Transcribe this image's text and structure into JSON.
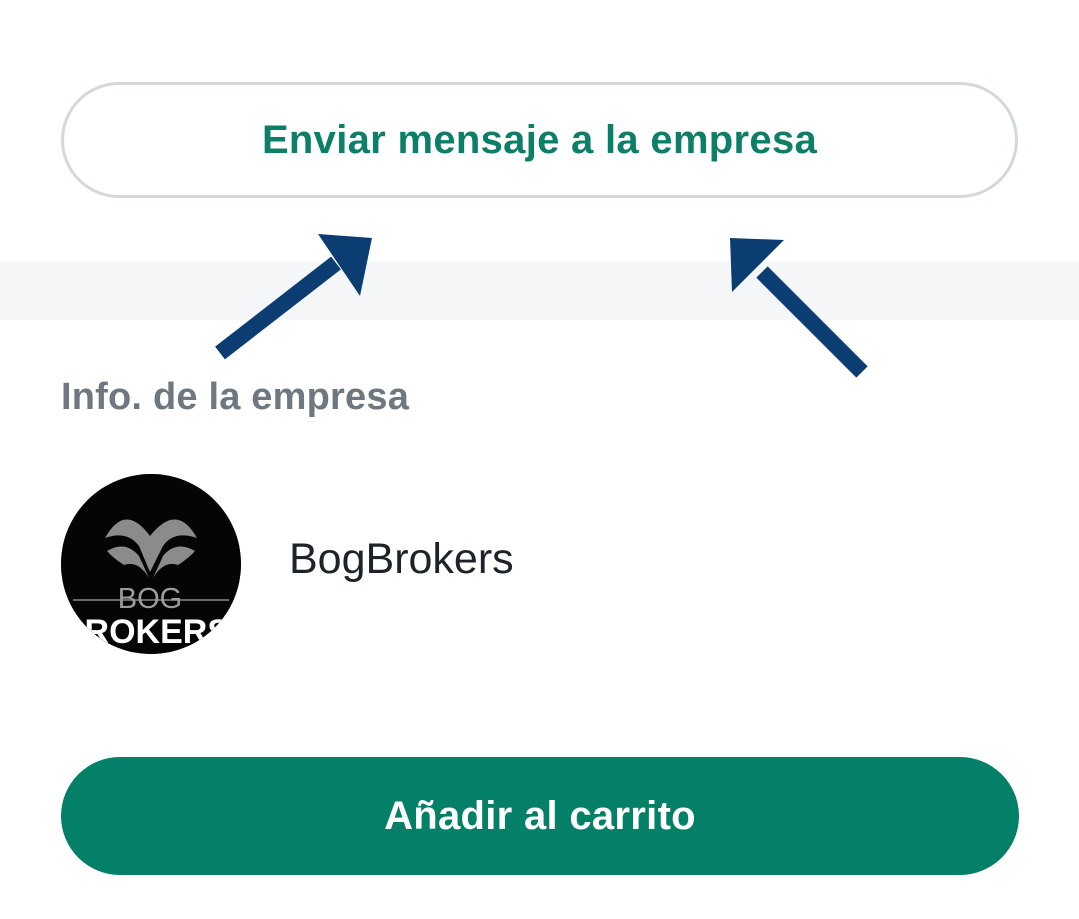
{
  "actions": {
    "message_label": "Enviar mensaje a la empresa",
    "cart_label": "Añadir al carrito"
  },
  "company_section": {
    "title": "Info. de la empresa",
    "name": "BogBrokers",
    "logo_text_top": "BOG",
    "logo_text_bottom": "BROKERS"
  },
  "annotations": {
    "arrow_icon": "arrow-up-right-icon",
    "arrow_icon_2": "arrow-up-left-icon"
  },
  "colors": {
    "accent": "#048068",
    "accent_text": "#0d7f68",
    "section_title": "#6d7880",
    "arrow": "#0b3d73",
    "border": "#d5d8db",
    "band": "#f5f6f8"
  }
}
